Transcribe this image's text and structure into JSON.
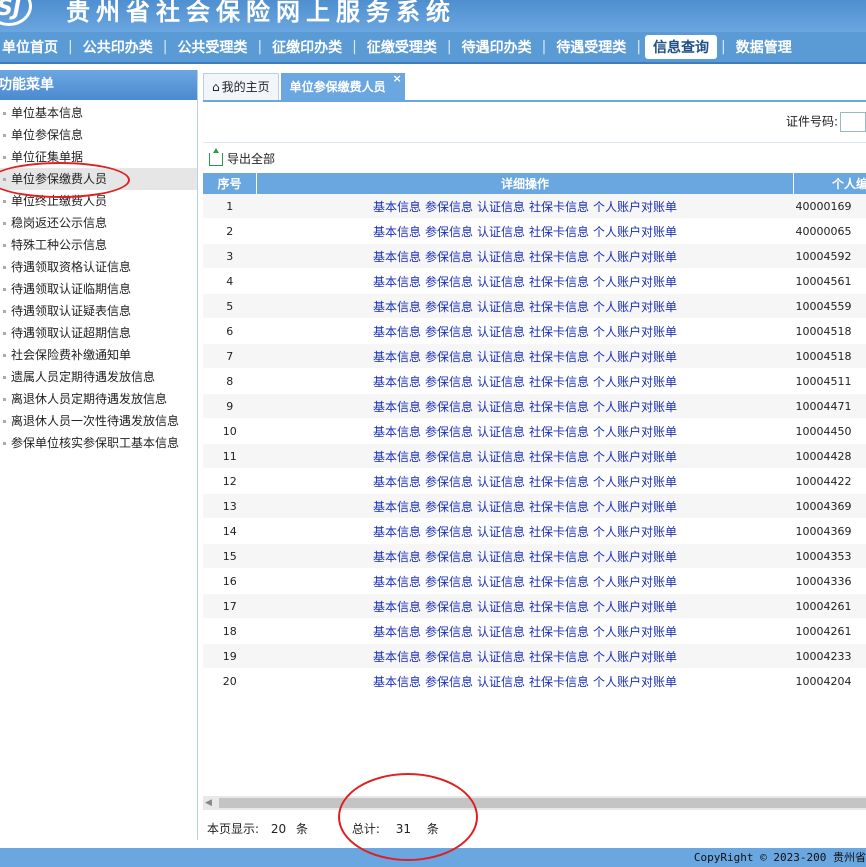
{
  "header": {
    "title": "贵州省社会保险网上服务系统"
  },
  "nav": [
    {
      "label": "单位首页"
    },
    {
      "label": "公共印办类"
    },
    {
      "label": "公共受理类"
    },
    {
      "label": "征缴印办类"
    },
    {
      "label": "征缴受理类"
    },
    {
      "label": "待遇印办类"
    },
    {
      "label": "待遇受理类"
    },
    {
      "label": "信息查询",
      "active": true
    },
    {
      "label": "数据管理"
    }
  ],
  "menu": {
    "title": "功能菜单",
    "items": [
      "单位基本信息",
      "单位参保信息",
      "单位征集单据",
      "单位参保缴费人员",
      "单位终止缴费人员",
      "稳岗返还公示信息",
      "特殊工种公示信息",
      "待遇领取资格认证信息",
      "待遇领取认证临期信息",
      "待遇领取认证疑表信息",
      "待遇领取认证超期信息",
      "社会保险费补缴通知单",
      "遗属人员定期待遇发放信息",
      "离退休人员定期待遇发放信息",
      "离退休人员一次性待遇发放信息",
      "参保单位核实参保职工基本信息"
    ],
    "selected_index": 3
  },
  "tabs": {
    "home": "我的主页",
    "active": "单位参保缴费人员",
    "close": "×"
  },
  "search": {
    "label": "证件号码:"
  },
  "toolbar": {
    "export": "导出全部"
  },
  "table": {
    "headers": [
      "序号",
      "详细操作",
      "个人编"
    ],
    "ops": [
      "基本信息",
      "参保信息",
      "认证信息",
      "社保卡信息",
      "个人账户对账单"
    ],
    "rows": [
      {
        "no": "1",
        "code": "40000169"
      },
      {
        "no": "2",
        "code": "40000065"
      },
      {
        "no": "3",
        "code": "10004592"
      },
      {
        "no": "4",
        "code": "10004561"
      },
      {
        "no": "5",
        "code": "10004559"
      },
      {
        "no": "6",
        "code": "10004518"
      },
      {
        "no": "7",
        "code": "10004518"
      },
      {
        "no": "8",
        "code": "10004511"
      },
      {
        "no": "9",
        "code": "10004471"
      },
      {
        "no": "10",
        "code": "10004450"
      },
      {
        "no": "11",
        "code": "10004428"
      },
      {
        "no": "12",
        "code": "10004422"
      },
      {
        "no": "13",
        "code": "10004369"
      },
      {
        "no": "14",
        "code": "10004369"
      },
      {
        "no": "15",
        "code": "10004353"
      },
      {
        "no": "16",
        "code": "10004336"
      },
      {
        "no": "17",
        "code": "10004261"
      },
      {
        "no": "18",
        "code": "10004261"
      },
      {
        "no": "19",
        "code": "10004233"
      },
      {
        "no": "20",
        "code": "10004204"
      }
    ]
  },
  "pager": {
    "page_label": "本页显示:",
    "page_count": "20",
    "unit": "条",
    "total_label": "总计:",
    "total_count": "31"
  },
  "footer": {
    "copyright": "CopyRight © 2023-200 贵州省"
  },
  "colors": {
    "brand": "#5b9bd5",
    "link": "#1a2fb8",
    "annotation": "#e02020"
  }
}
